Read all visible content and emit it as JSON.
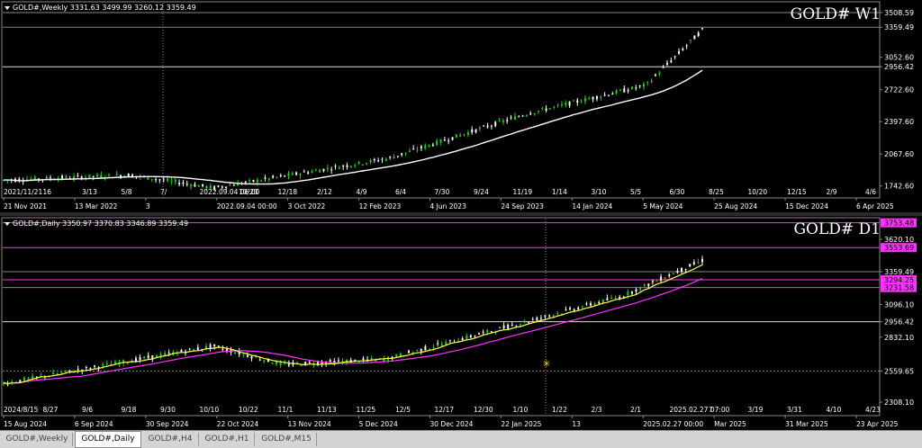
{
  "charts": [
    {
      "id": "w1",
      "symbol_line": "GOLD#,Weekly  3331.63 3499.99 3260.12 3359.49",
      "big_label": "GOLD# W1",
      "price_labels": [
        "3508.59",
        "3359.49",
        "3052.60",
        "2956.42",
        "2722.60",
        "2397.60",
        "2067.60",
        "1742.60"
      ],
      "price_values": [
        3508.59,
        3359.49,
        3052.6,
        2956.42,
        2722.6,
        2397.6,
        2067.6,
        1742.6
      ],
      "hlines": [
        {
          "value": 3359.49,
          "color": "#888888"
        },
        {
          "value": 2956.42,
          "color": "#dddddd"
        },
        {
          "value": 3508.59,
          "color": "#888888"
        }
      ],
      "ymin": 1620,
      "ymax": 3600,
      "date_labels": [
        "2021/11/21",
        "16",
        "3/13",
        "5/8",
        "7/",
        "2022.09.04 06:00",
        "10/23",
        "12/18",
        "2/12",
        "4/9",
        "6/4",
        "7/30",
        "9/24",
        "11/19",
        "1/14",
        "3/10",
        "5/5",
        "6/30",
        "8/25",
        "10/20",
        "12/15",
        "2/9",
        "4/6"
      ],
      "axis_labels": [
        "21 Nov 2021",
        "13 Mar 2022",
        "3",
        "2022.09.04 00:00",
        "3 Oct 2022",
        "12 Feb 2023",
        "4 Jun 2023",
        "24 Sep 2023",
        "14 Jan 2024",
        "5 May 2024",
        "25 Aug 2024",
        "15 Dec 2024",
        "6 Apr 2025"
      ]
    },
    {
      "id": "d1",
      "symbol_line": "GOLD#,Daily  3350.97 3370.83 3346.89 3359.49",
      "big_label": "GOLD# D1",
      "price_labels": [
        "3753.48",
        "3620.10",
        "3553.69",
        "3359.49",
        "3294.25",
        "3231.58",
        "3096.10",
        "2956.42",
        "2832.10",
        "2559.65",
        "2308.10"
      ],
      "price_values": [
        3753.48,
        3620.1,
        3553.69,
        3359.49,
        3294.25,
        3231.58,
        3096.1,
        2956.42,
        2832.1,
        2559.65,
        2308.1
      ],
      "price_label_colors": [
        "#ff33ff",
        "",
        "#ff33ff",
        "",
        "#ff33ff",
        "#ff33ff",
        "",
        "",
        "",
        "",
        ""
      ],
      "hlines": [
        {
          "value": 3753.48,
          "color": "#ff33ff"
        },
        {
          "value": 3553.69,
          "color": "#ff33ff"
        },
        {
          "value": 3359.49,
          "color": "#888888"
        },
        {
          "value": 3294.25,
          "color": "#ff33ff"
        },
        {
          "value": 3231.58,
          "color": "#ff33ff"
        },
        {
          "value": 2956.42,
          "color": "#dddddd"
        },
        {
          "value": 2559.65,
          "color": "#888888",
          "dash": true
        }
      ],
      "ymin": 2200,
      "ymax": 3780,
      "date_labels": [
        "2024/8/15",
        "8/27",
        "9/6",
        "9/18",
        "9/30",
        "10/10",
        "10/22",
        "11/1",
        "11/13",
        "11/25",
        "12/5",
        "12/17",
        "12/30",
        "1/10",
        "1/22",
        "2/3",
        "2/1",
        "2025.02.27 07:00",
        "7",
        "3/19",
        "3/31",
        "4/10",
        "4/23"
      ],
      "axis_labels": [
        "15 Aug 2024",
        "6 Sep 2024",
        "30 Sep 2024",
        "22 Oct 2024",
        "13 Nov 2024",
        "5 Dec 2024",
        "30 Dec 2024",
        "22 Jan 2025",
        "13",
        "2025.02.27 00:00",
        "Mar 2025",
        "31 Mar 2025",
        "23 Apr 2025"
      ]
    }
  ],
  "tabs": [
    {
      "label": "GOLD#,Weekly",
      "active": false
    },
    {
      "label": "GOLD#,Daily",
      "active": true
    },
    {
      "label": "GOLD#,H4",
      "active": false
    },
    {
      "label": "GOLD#,H1",
      "active": false
    },
    {
      "label": "GOLD#,M15",
      "active": false
    }
  ],
  "colors": {
    "bull": "#22cc22",
    "bear": "#ffffff",
    "ma_w": "#ffffff",
    "ma_d_slow": "#ff33ff",
    "ma_d_fast": "#ffff44"
  }
}
